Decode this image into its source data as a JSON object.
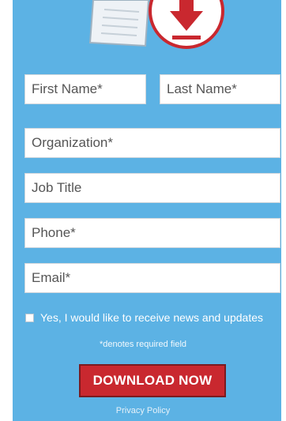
{
  "form": {
    "first_name_placeholder": "First Name*",
    "last_name_placeholder": "Last Name*",
    "organization_placeholder": "Organization*",
    "job_title_placeholder": "Job Title",
    "phone_placeholder": "Phone*",
    "email_placeholder": "Email*",
    "newsletter_label": "Yes, I would like to receive news and updates",
    "newsletter_checked": false,
    "required_note": "*denotes required field",
    "download_label": "DOWNLOAD NOW",
    "privacy_label": "Privacy Policy"
  },
  "icons": {
    "document": "document-icon",
    "download": "download-arrow-icon"
  },
  "colors": {
    "panel_background": "#5cb2e4",
    "button_background": "#c9282f",
    "download_icon": "#c9282f"
  }
}
